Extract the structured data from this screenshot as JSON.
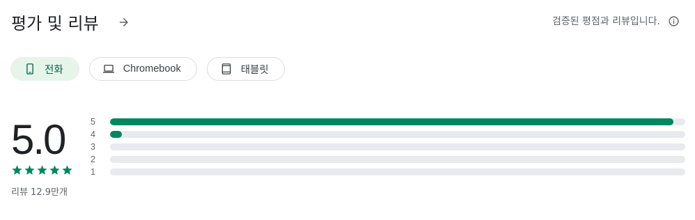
{
  "header": {
    "title": "평가 및 리뷰",
    "arrow_icon": "arrow-right-icon"
  },
  "verified": {
    "text": "검증된 평점과 리뷰입니다.",
    "info_icon": "info-icon"
  },
  "chips": [
    {
      "label": "전화",
      "icon": "phone-icon",
      "selected": true
    },
    {
      "label": "Chromebook",
      "icon": "laptop-icon",
      "selected": false
    },
    {
      "label": "태블릿",
      "icon": "tablet-icon",
      "selected": false
    }
  ],
  "rating": {
    "score": "5.0",
    "stars": 5,
    "reviews_label": "리뷰 12.9만개"
  },
  "histogram": [
    {
      "label": "5",
      "fraction": 0.98
    },
    {
      "label": "4",
      "fraction": 0.02
    },
    {
      "label": "3",
      "fraction": 0
    },
    {
      "label": "2",
      "fraction": 0
    },
    {
      "label": "1",
      "fraction": 0
    }
  ],
  "colors": {
    "accent": "#01875f",
    "chip_selected_bg": "#e6f4ea",
    "track": "#e8eaed"
  }
}
